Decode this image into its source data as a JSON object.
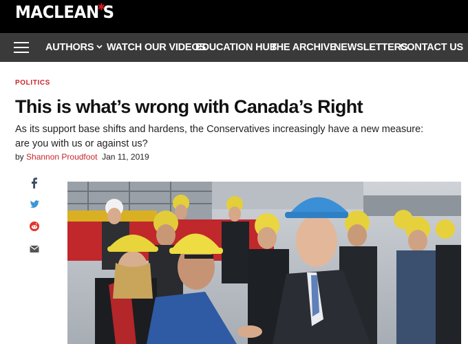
{
  "brand": {
    "logo_text_1": "MACLEAN",
    "logo_text_2": "S"
  },
  "nav": {
    "items": [
      {
        "label": "AUTHORS"
      },
      {
        "label": "WATCH OUR VIDEOS"
      },
      {
        "label": "EDUCATION HUB"
      },
      {
        "label": "THE ARCHIVE"
      },
      {
        "label": "NEWSLETTERS"
      },
      {
        "label": "CONTACT US"
      }
    ]
  },
  "article": {
    "section": "POLITICS",
    "headline": "This is what’s wrong with Canada’s Right",
    "dek": "As its support base shifts and hardens, the Conservatives increasingly have a new measure: are you with us or against us?",
    "byline_prefix": "by",
    "author": "Shannon Proudfoot",
    "date": "Jan 11, 2019"
  },
  "share": {
    "icons": [
      "facebook-icon",
      "twitter-icon",
      "reddit-icon",
      "email-icon"
    ]
  },
  "colors": {
    "accent": "#c8262c",
    "topbar": "#000000",
    "navbar": "#3a3a3a"
  }
}
